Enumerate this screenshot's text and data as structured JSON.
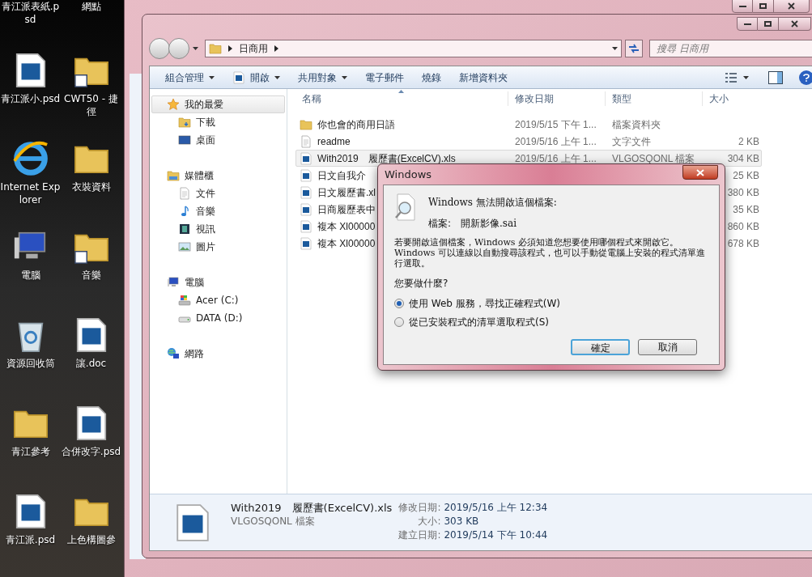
{
  "desktop": {
    "icons": [
      {
        "label": "青江派表紙.psd",
        "kind": "cut"
      },
      {
        "label": "網點",
        "kind": "cut"
      },
      {
        "label": "青江派小.psd",
        "kind": "psd"
      },
      {
        "label": "CWT50 - 捷徑",
        "kind": "shortcut-folder"
      },
      {
        "label": "Internet Explorer",
        "kind": "browser"
      },
      {
        "label": "衣裝資料",
        "kind": "folder"
      },
      {
        "label": "電腦",
        "kind": "computer"
      },
      {
        "label": "音樂",
        "kind": "shortcut-folder"
      },
      {
        "label": "資源回收筒",
        "kind": "recycle"
      },
      {
        "label": "讓.doc",
        "kind": "psd"
      },
      {
        "label": "青江參考",
        "kind": "folder"
      },
      {
        "label": "合併改字.psd",
        "kind": "psd"
      },
      {
        "label": "青江派.psd",
        "kind": "psd"
      },
      {
        "label": "上色構圖參",
        "kind": "folder"
      }
    ]
  },
  "explorer": {
    "breadcrumb": [
      "日商用"
    ],
    "search": {
      "placeholder": "搜尋 日商用"
    },
    "toolbar": [
      {
        "label": "組合管理",
        "menu": true,
        "kind": "plain"
      },
      {
        "label": "開啟",
        "menu": true,
        "kind": "ps"
      },
      {
        "label": "共用對象",
        "menu": true,
        "kind": "plain"
      },
      {
        "label": "電子郵件",
        "menu": false,
        "kind": "plain"
      },
      {
        "label": "燒錄",
        "menu": false,
        "kind": "plain"
      },
      {
        "label": "新增資料夾",
        "menu": false,
        "kind": "plain"
      }
    ],
    "sidebar": [
      {
        "label": "我的最愛",
        "kind": "star",
        "selected": true,
        "children": [
          {
            "label": "下載",
            "kind": "download",
            "selected": false
          },
          {
            "label": "桌面",
            "kind": "desktop",
            "selected": false
          }
        ]
      },
      {
        "label": "媒體櫃",
        "kind": "library",
        "selected": false,
        "children": [
          {
            "label": "文件",
            "kind": "document",
            "selected": false
          },
          {
            "label": "音樂",
            "kind": "music",
            "selected": false
          },
          {
            "label": "視訊",
            "kind": "video",
            "selected": false
          },
          {
            "label": "圖片",
            "kind": "picture",
            "selected": false
          }
        ]
      },
      {
        "label": "電腦",
        "kind": "computer",
        "selected": false,
        "children": [
          {
            "label": "Acer (C:)",
            "kind": "system-drive",
            "selected": false
          },
          {
            "label": "DATA (D:)",
            "kind": "drive",
            "selected": false
          }
        ]
      },
      {
        "label": "網路",
        "kind": "network",
        "selected": false
      }
    ],
    "columns": [
      "名稱",
      "修改日期",
      "類型",
      "大小"
    ],
    "rows": [
      {
        "name": "你也會的商用日語",
        "date": "2019/5/15 下午 1...",
        "type": "檔案資料夾",
        "kind": "folder",
        "selected": false
      },
      {
        "name": "readme",
        "date": "2019/5/16 上午 1...",
        "type": "文字文件",
        "size": "2 KB",
        "kind": "text",
        "selected": false
      },
      {
        "name": "With2019　履歷書(ExcelCV).xls",
        "date": "2019/5/16 上午 1...",
        "type": "VLGOSQONL 檔案",
        "size": "304 KB",
        "kind": "ps",
        "selected": true
      },
      {
        "name": "日文自我介",
        "size": "25 KB",
        "kind": "ps",
        "selected": false
      },
      {
        "name": "日文履歷書.xl",
        "size": "380 KB",
        "kind": "ps",
        "selected": false
      },
      {
        "name": "日商履歷表中",
        "size": "35 KB",
        "kind": "ps",
        "selected": false
      },
      {
        "name": "複本 Xl00000",
        "size": "860 KB",
        "kind": "ps",
        "selected": false
      },
      {
        "name": "複本 Xl00000",
        "size": "678 KB",
        "kind": "ps",
        "selected": false
      }
    ],
    "details": {
      "name": "With2019　履歷書(ExcelCV).xls",
      "type": "VLGOSQONL 檔案",
      "fields": [
        {
          "label": "修改日期:",
          "value": "2019/5/16 上午 12:34"
        },
        {
          "label": "大小:",
          "value": "303 KB"
        },
        {
          "label": "建立日期:",
          "value": "2019/5/14 下午 10:44"
        }
      ]
    }
  },
  "dialog": {
    "title": "Windows",
    "heading": "Windows 無法開啟這個檔案:",
    "file_label": "檔案:",
    "file_name": "開新影像.sai",
    "message": "若要開啟這個檔案，Windows 必須知道您想要使用哪個程式來開啟它。Windows 可以連線以自動搜尋該程式，也可以手動從電腦上安裝的程式清單進行選取。",
    "question": "您要做什麼?",
    "options": [
      {
        "label": "使用 Web 服務，尋找正確程式(W)",
        "selected": true
      },
      {
        "label": "從已安裝程式的清單選取程式(S)",
        "selected": false
      }
    ],
    "buttons": [
      {
        "label": "確定",
        "default": true
      },
      {
        "label": "取消",
        "default": false
      }
    ]
  }
}
